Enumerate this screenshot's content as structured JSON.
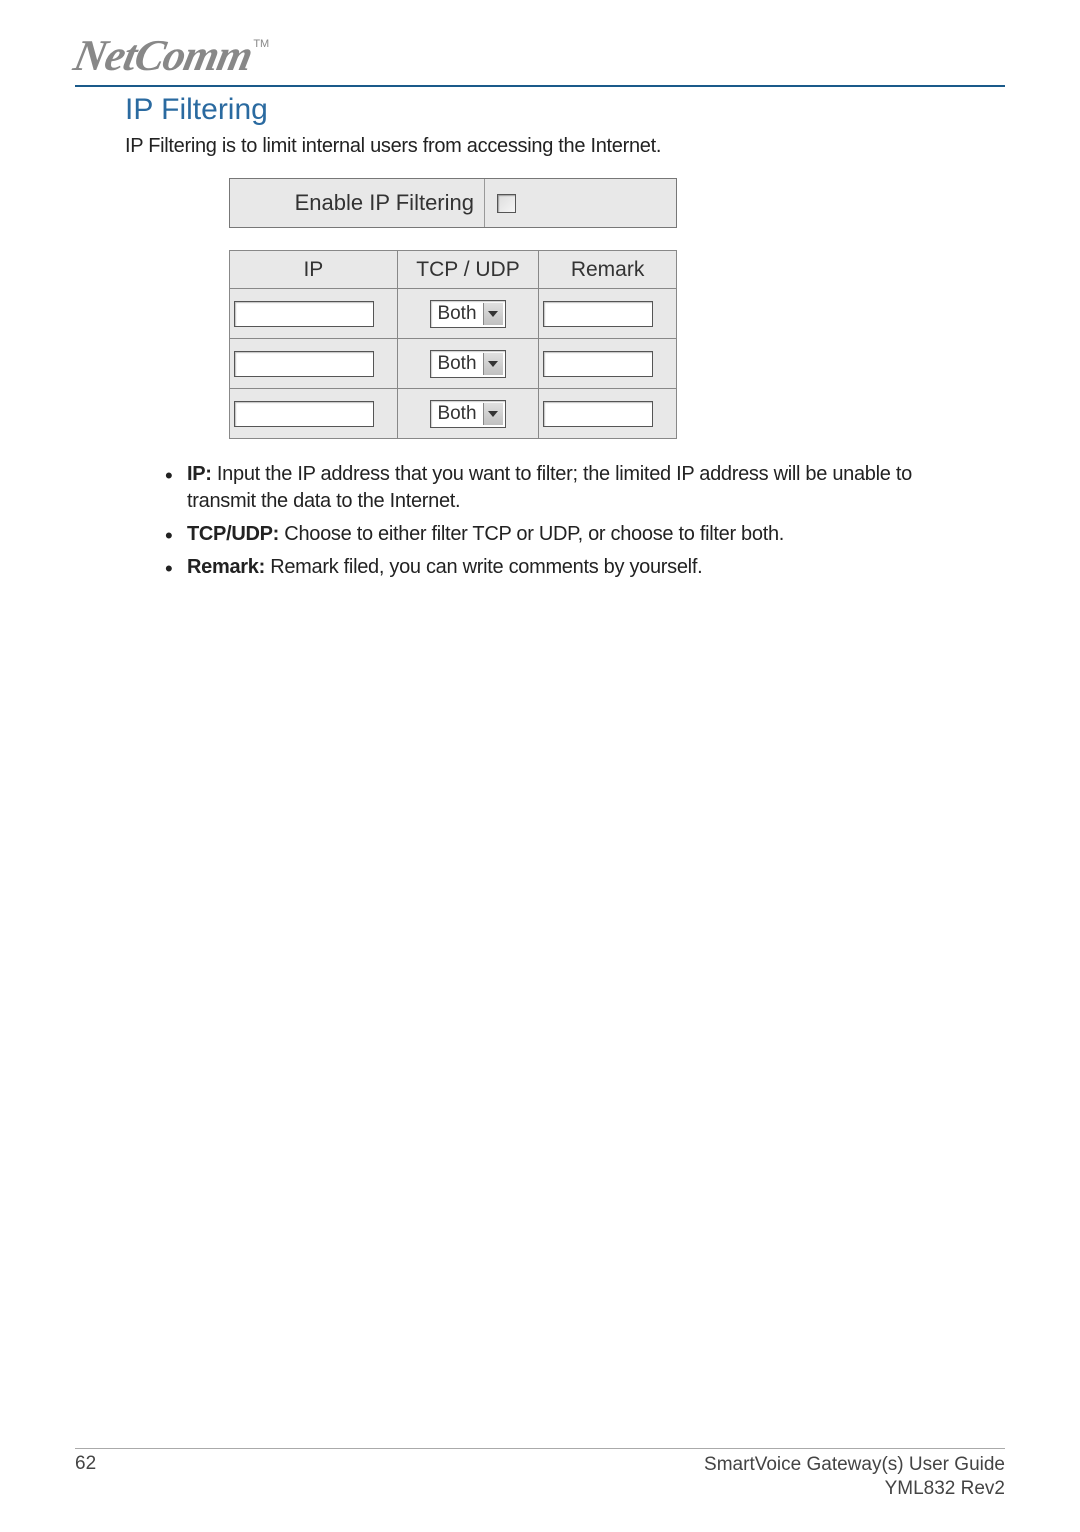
{
  "brand": {
    "name": "NetComm",
    "tm": "TM"
  },
  "section": {
    "title": "IP Filtering",
    "intro": "IP Filtering is to limit internal users from accessing the Internet."
  },
  "ui": {
    "enable_label": "Enable IP Filtering",
    "headers": {
      "ip": "IP",
      "proto": "TCP / UDP",
      "remark": "Remark"
    },
    "rows": [
      {
        "ip": "",
        "proto": "Both",
        "remark": ""
      },
      {
        "ip": "",
        "proto": "Both",
        "remark": ""
      },
      {
        "ip": "",
        "proto": "Both",
        "remark": ""
      }
    ]
  },
  "bullets": [
    {
      "label": "IP:",
      "text": " Input the IP address that you want to filter; the limited IP address will be unable to transmit the data to the Internet."
    },
    {
      "label": "TCP/UDP:",
      "text": " Choose to either filter TCP or UDP, or choose to filter both."
    },
    {
      "label": "Remark:",
      "text": " Remark filed, you can write comments by yourself."
    }
  ],
  "footer": {
    "page": "62",
    "guide": "SmartVoice Gateway(s) User Guide",
    "rev": "YML832 Rev2"
  }
}
